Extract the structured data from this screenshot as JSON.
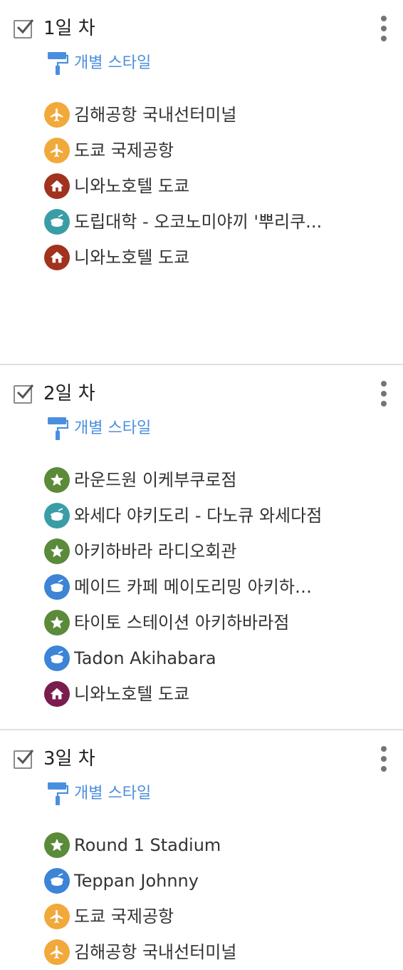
{
  "colors": {
    "airport": "#f2a93b",
    "hotel_red": "#a0321e",
    "hotel_purple": "#7b1c4f",
    "dining_teal": "#3a9da6",
    "dining_blue": "#3c84d6",
    "attraction": "#5a8a3a",
    "link": "#4a8fde"
  },
  "style_link_label": "개별 스타일",
  "layers": [
    {
      "title": "1일 차",
      "checked": true,
      "items": [
        {
          "label": "김해공항 국내선터미널",
          "icon": "airplane-icon",
          "color": "#f2a93b"
        },
        {
          "label": "도쿄 국제공항",
          "icon": "airplane-icon",
          "color": "#f2a93b"
        },
        {
          "label": "니와노호텔 도쿄",
          "icon": "home-icon",
          "color": "#a0321e"
        },
        {
          "label": "도립대학 - 오코노미야끼 '뿌리쿠...",
          "icon": "dining-icon",
          "color": "#3a9da6"
        },
        {
          "label": "니와노호텔 도쿄",
          "icon": "home-icon",
          "color": "#a0321e"
        }
      ]
    },
    {
      "title": "2일 차",
      "checked": true,
      "items": [
        {
          "label": "라운드원 이케부쿠로점",
          "icon": "star-icon",
          "color": "#5a8a3a"
        },
        {
          "label": "와세다 야키도리 - 다노큐 와세다점",
          "icon": "dining-icon",
          "color": "#3a9da6"
        },
        {
          "label": "아키하바라 라디오회관",
          "icon": "star-icon",
          "color": "#5a8a3a"
        },
        {
          "label": "메이드 카페 메이도리밍 아키하바...",
          "icon": "dining-icon",
          "color": "#3c84d6"
        },
        {
          "label": "타이토 스테이션 아키하바라점",
          "icon": "star-icon",
          "color": "#5a8a3a"
        },
        {
          "label": "Tadon Akihabara",
          "icon": "dining-icon",
          "color": "#3c84d6"
        },
        {
          "label": "니와노호텔 도쿄",
          "icon": "home-icon",
          "color": "#7b1c4f"
        }
      ]
    },
    {
      "title": "3일 차",
      "checked": true,
      "items": [
        {
          "label": "Round 1 Stadium",
          "icon": "star-icon",
          "color": "#5a8a3a"
        },
        {
          "label": "Teppan Johnny",
          "icon": "dining-icon",
          "color": "#3c84d6"
        },
        {
          "label": "도쿄 국제공항",
          "icon": "airplane-icon",
          "color": "#f2a93b"
        },
        {
          "label": "김해공항 국내선터미널",
          "icon": "airplane-icon",
          "color": "#f2a93b"
        }
      ]
    }
  ]
}
